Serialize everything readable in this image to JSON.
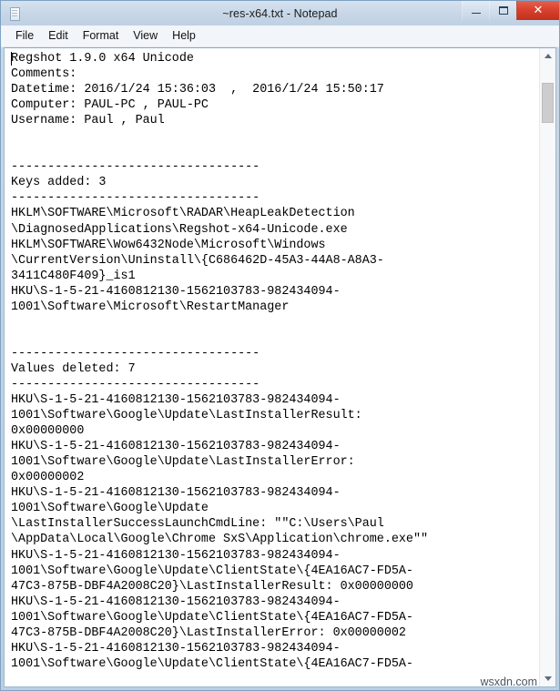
{
  "window": {
    "title": "~res-x64.txt - Notepad",
    "app_icon": "notepad-icon",
    "controls": {
      "minimize_label": "–",
      "maximize_label": "",
      "close_label": "✕"
    }
  },
  "menu": {
    "items": [
      {
        "label": "File"
      },
      {
        "label": "Edit"
      },
      {
        "label": "Format"
      },
      {
        "label": "View"
      },
      {
        "label": "Help"
      }
    ]
  },
  "scrollbar": {
    "up_arrow": "chevron-up-icon",
    "down_arrow": "chevron-down-icon",
    "thumb_position_percent": 3
  },
  "watermark": {
    "text": "wsxdn.com"
  },
  "document": {
    "filename": "~res-x64.txt",
    "header": {
      "product": "Regshot 1.9.0 x64 Unicode",
      "comments_label": "Comments:",
      "comments_value": "",
      "datetime_label": "Datetime:",
      "datetime_value": "2016/1/24 15:36:03  ,  2016/1/24 15:50:17",
      "computer_label": "Computer:",
      "computer_value": "PAUL-PC , PAUL-PC",
      "username_label": "Username:",
      "username_value": "Paul , Paul"
    },
    "separator": "----------------------------------",
    "sections": [
      {
        "heading": "Keys added: 3",
        "count": 3
      },
      {
        "heading": "Values deleted: 7",
        "count": 7
      }
    ],
    "lines": [
      "Regshot 1.9.0 x64 Unicode",
      "Comments:",
      "Datetime: 2016/1/24 15:36:03  ,  2016/1/24 15:50:17",
      "Computer: PAUL-PC , PAUL-PC",
      "Username: Paul , Paul",
      "",
      "",
      "----------------------------------",
      "Keys added: 3",
      "----------------------------------",
      "HKLM\\SOFTWARE\\Microsoft\\RADAR\\HeapLeakDetection",
      "\\DiagnosedApplications\\Regshot-x64-Unicode.exe",
      "HKLM\\SOFTWARE\\Wow6432Node\\Microsoft\\Windows",
      "\\CurrentVersion\\Uninstall\\{C686462D-45A3-44A8-A8A3-",
      "3411C480F409}_is1",
      "HKU\\S-1-5-21-4160812130-1562103783-982434094-",
      "1001\\Software\\Microsoft\\RestartManager",
      "",
      "",
      "----------------------------------",
      "Values deleted: 7",
      "----------------------------------",
      "HKU\\S-1-5-21-4160812130-1562103783-982434094-",
      "1001\\Software\\Google\\Update\\LastInstallerResult:",
      "0x00000000",
      "HKU\\S-1-5-21-4160812130-1562103783-982434094-",
      "1001\\Software\\Google\\Update\\LastInstallerError:",
      "0x00000002",
      "HKU\\S-1-5-21-4160812130-1562103783-982434094-",
      "1001\\Software\\Google\\Update",
      "\\LastInstallerSuccessLaunchCmdLine: \"\"C:\\Users\\Paul",
      "\\AppData\\Local\\Google\\Chrome SxS\\Application\\chrome.exe\"\"",
      "HKU\\S-1-5-21-4160812130-1562103783-982434094-",
      "1001\\Software\\Google\\Update\\ClientState\\{4EA16AC7-FD5A-",
      "47C3-875B-DBF4A2008C20}\\LastInstallerResult: 0x00000000",
      "HKU\\S-1-5-21-4160812130-1562103783-982434094-",
      "1001\\Software\\Google\\Update\\ClientState\\{4EA16AC7-FD5A-",
      "47C3-875B-DBF4A2008C20}\\LastInstallerError: 0x00000002",
      "HKU\\S-1-5-21-4160812130-1562103783-982434094-",
      "1001\\Software\\Google\\Update\\ClientState\\{4EA16AC7-FD5A-"
    ]
  }
}
